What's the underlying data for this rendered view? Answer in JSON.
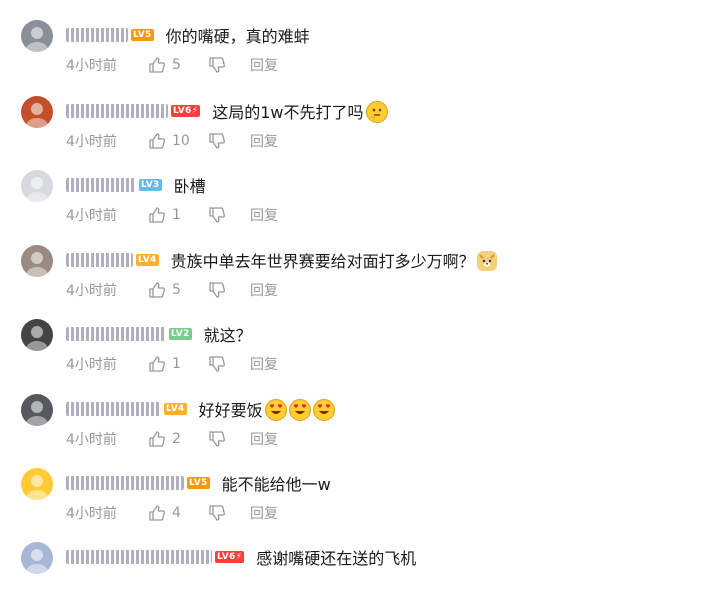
{
  "comments": [
    {
      "user_width": 62,
      "level": "LV5",
      "level_color": "#ff9800",
      "text": "你的嘴硬，真的难蚌",
      "time": "4小时前",
      "likes": "5",
      "reply": "回复",
      "emojis": [],
      "avatar": "#8a8f99"
    },
    {
      "user_width": 102,
      "level": "LV6⚡",
      "level_color": "#ff3d3d",
      "text": "这局的1w不先打了吗",
      "time": "4小时前",
      "likes": "10",
      "reply": "回复",
      "emojis": [
        "thinking-face"
      ],
      "avatar": "#c4502b"
    },
    {
      "user_width": 70,
      "level": "LV3",
      "level_color": "#6ab8e6",
      "text": "卧槽",
      "time": "4小时前",
      "likes": "1",
      "reply": "回复",
      "emojis": [],
      "avatar": "#d8d9df"
    },
    {
      "user_width": 67,
      "level": "LV4",
      "level_color": "#ffb027",
      "text": "贵族中单去年世界赛要给对面打多少万啊？",
      "time": "4小时前",
      "likes": "5",
      "reply": "回复",
      "emojis": [
        "doge"
      ],
      "avatar": "#9a8a80"
    },
    {
      "user_width": 100,
      "level": "LV2",
      "level_color": "#7bcc8c",
      "text": "就这？",
      "time": "4小时前",
      "likes": "1",
      "reply": "回复",
      "emojis": [],
      "avatar": "#444444"
    },
    {
      "user_width": 95,
      "level": "LV4",
      "level_color": "#ffb027",
      "text": "好好要饭",
      "time": "4小时前",
      "likes": "2",
      "reply": "回复",
      "emojis": [
        "heart-eyes",
        "heart-eyes",
        "heart-eyes"
      ],
      "avatar": "#56585e"
    },
    {
      "user_width": 118,
      "level": "LV5",
      "level_color": "#ff9800",
      "text": "能不能给他一w",
      "time": "4小时前",
      "likes": "4",
      "reply": "回复",
      "emojis": [],
      "avatar": "#ffcc33"
    },
    {
      "user_width": 146,
      "level": "LV6⚡",
      "level_color": "#ff3d3d",
      "text": "感谢嘴硬还在送的飞机",
      "time": "",
      "likes": "",
      "reply": "",
      "emojis": [],
      "avatar": "#a7b8d6"
    }
  ]
}
